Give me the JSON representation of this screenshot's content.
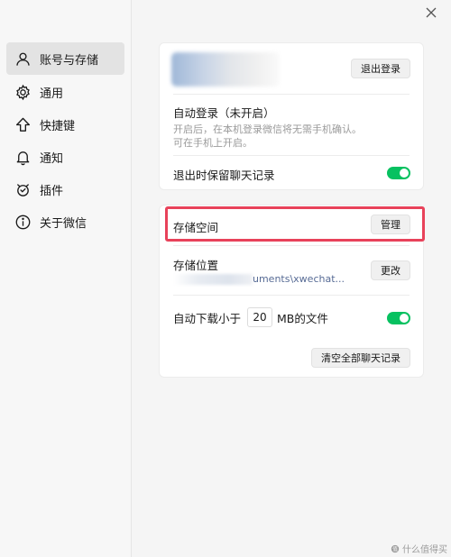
{
  "sidebar": {
    "items": [
      {
        "label": "账号与存储",
        "icon": "user-icon",
        "active": true
      },
      {
        "label": "通用",
        "icon": "gear-icon",
        "active": false
      },
      {
        "label": "快捷键",
        "icon": "arrow-up-icon",
        "active": false
      },
      {
        "label": "通知",
        "icon": "bell-icon",
        "active": false
      },
      {
        "label": "插件",
        "icon": "plugin-icon",
        "active": false
      },
      {
        "label": "关于微信",
        "icon": "info-icon",
        "active": false
      }
    ]
  },
  "account": {
    "logout_label": "退出登录",
    "auto_login_title": "自动登录（未开启）",
    "auto_login_desc_1": "开启后，在本机登录微信将无需手机确认。",
    "auto_login_desc_2": "可在手机上开启。",
    "keep_history_label": "退出时保留聊天记录",
    "keep_history_on": true
  },
  "storage": {
    "space_label": "存储空间",
    "manage_label": "管理",
    "location_label": "存储位置",
    "location_path": "uments\\xwechat...",
    "change_label": "更改",
    "auto_download_prefix": "自动下载小于",
    "auto_download_value": "20",
    "auto_download_suffix": "MB的文件",
    "auto_download_on": true,
    "clear_label": "清空全部聊天记录"
  },
  "watermark": "什么值得买",
  "colors": {
    "accent_green": "#07c160",
    "highlight_red": "#e8425a",
    "link_blue": "#576b95"
  }
}
